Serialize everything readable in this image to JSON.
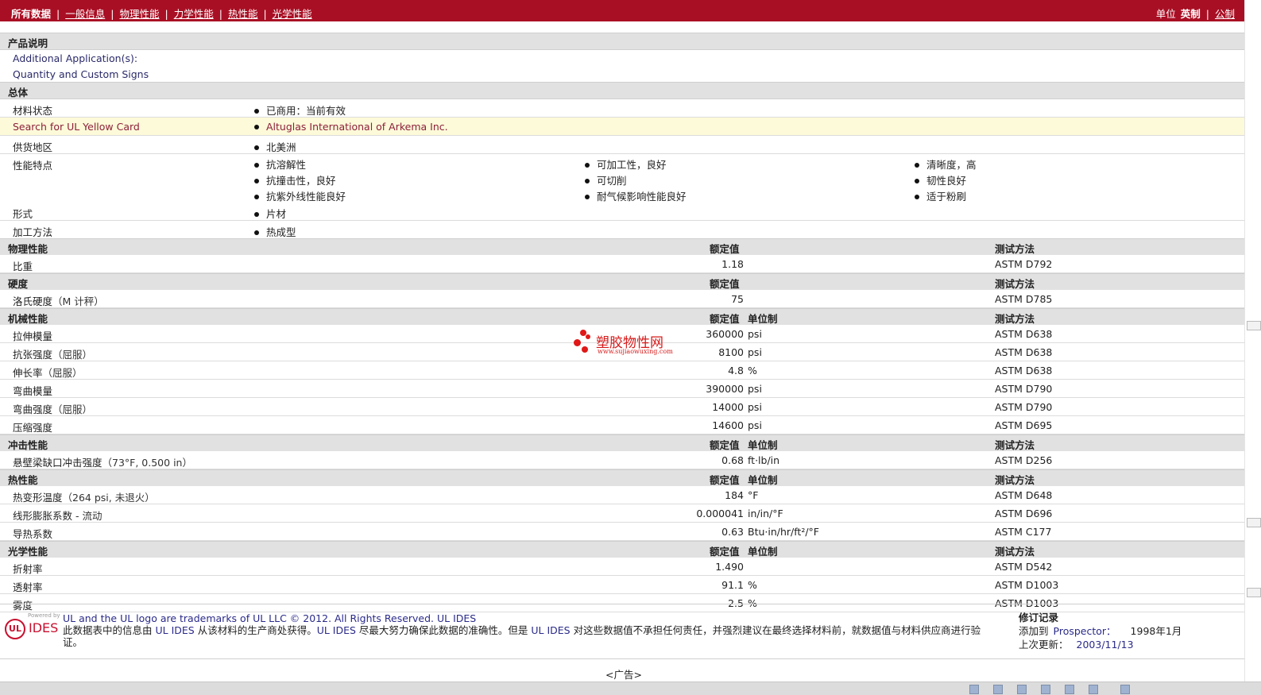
{
  "nav": {
    "tabs": [
      "所有数据",
      "一般信息",
      "物理性能",
      "力学性能",
      "热性能",
      "光学性能"
    ],
    "units_label": "单位",
    "units": [
      "英制",
      "公制"
    ]
  },
  "product_desc": {
    "heading": "产品说明",
    "line1": "Additional Application(s):",
    "line2": "Quantity and Custom Signs"
  },
  "general": {
    "heading": "总体",
    "rows": [
      {
        "label": "材料状态",
        "value": "已商用：当前有效"
      },
      {
        "label": "Search for UL Yellow Card",
        "value": "Altuglas International of Arkema Inc."
      },
      {
        "label": "供货地区",
        "value": "北美洲"
      }
    ],
    "features_label": "性能特点",
    "features": [
      [
        "抗溶解性",
        "抗撞击性，良好",
        "抗紫外线性能良好"
      ],
      [
        "可加工性，良好",
        "可切削",
        "耐气候影响性能良好"
      ],
      [
        "清晰度，高",
        "韧性良好",
        "适于粉刷"
      ]
    ],
    "form_label": "形式",
    "form": "片材",
    "process_label": "加工方法",
    "process": "热成型"
  },
  "headers": {
    "nominal": "额定值",
    "unit": "单位制",
    "test": "测试方法"
  },
  "sections": [
    {
      "title": "物理性能",
      "show_unit": false,
      "rows": [
        {
          "label": "比重",
          "note": "",
          "value": "1.18",
          "unit": "",
          "test": "ASTM D792"
        }
      ]
    },
    {
      "title": "硬度",
      "show_unit": false,
      "rows": [
        {
          "label": "洛氏硬度",
          "note": "（M 计秤）",
          "value": "75",
          "unit": "",
          "test": "ASTM D785"
        }
      ]
    },
    {
      "title": "机械性能",
      "show_unit": true,
      "rows": [
        {
          "label": "拉伸模量",
          "note": "",
          "value": "360000",
          "unit": "psi",
          "test": "ASTM D638"
        },
        {
          "label": "抗张强度",
          "note": "（屈服）",
          "value": "8100",
          "unit": "psi",
          "test": "ASTM D638"
        },
        {
          "label": "伸长率",
          "note": "（屈服）",
          "value": "4.8",
          "unit": "%",
          "test": "ASTM D638"
        },
        {
          "label": "弯曲模量",
          "note": "",
          "value": "390000",
          "unit": "psi",
          "test": "ASTM D790"
        },
        {
          "label": "弯曲强度",
          "note": "（屈服）",
          "value": "14000",
          "unit": "psi",
          "test": "ASTM D790"
        },
        {
          "label": "压缩强度",
          "note": "",
          "value": "14600",
          "unit": "psi",
          "test": "ASTM D695"
        }
      ]
    },
    {
      "title": "冲击性能",
      "show_unit": true,
      "rows": [
        {
          "label": "悬壁梁缺口冲击强度",
          "note": "（73°F, 0.500 in）",
          "value": "0.68",
          "unit": "ft·lb/in",
          "test": "ASTM D256"
        }
      ]
    },
    {
      "title": "热性能",
      "show_unit": true,
      "rows": [
        {
          "label": "热变形温度",
          "note": "（264 psi, 未退火）",
          "value": "184",
          "unit": "°F",
          "test": "ASTM D648"
        },
        {
          "label": "线形膨胀系数",
          "note": " - 流动",
          "value": "0.000041",
          "unit": "in/in/°F",
          "test": "ASTM D696"
        },
        {
          "label": "导热系数",
          "note": "",
          "value": "0.63",
          "unit": "Btu·in/hr/ft²/°F",
          "test": "ASTM C177"
        }
      ]
    },
    {
      "title": "光学性能",
      "show_unit": true,
      "rows": [
        {
          "label": "折射率",
          "note": "",
          "value": "1.490",
          "unit": "",
          "test": "ASTM D542"
        },
        {
          "label": "透射率",
          "note": "",
          "value": "91.1",
          "unit": "%",
          "test": "ASTM D1003"
        },
        {
          "label": "雾度",
          "note": "",
          "value": "2.5",
          "unit": "%",
          "test": "ASTM D1003"
        }
      ]
    }
  ],
  "watermark": {
    "cn": "塑胶物性网",
    "en": "www.sujiaowuxing.com"
  },
  "footer": {
    "logo_powered": "Powered by",
    "logo_ul": "UL",
    "logo_ides": "IDES",
    "trademark": "UL and the UL logo are trademarks of UL LLC © 2012. All Rights Reserved. UL IDES",
    "disclaimer_a": "此数据表中的信息由 ",
    "disclaimer_b": "UL IDES",
    "disclaimer_c": " 从该材料的生产商处获得。",
    "disclaimer_d": "UL IDES",
    "disclaimer_e": " 尽最大努力确保此数据的准确性。但是 ",
    "disclaimer_f": "UL IDES",
    "disclaimer_g": " 对这些数据值不承担任何责任，并强烈建议在最终选择材料前，就数据值与材料供应商进行验证。",
    "revision_title": "修订记录",
    "added_label": "添加到",
    "added_target": "Prospector：",
    "added_date": "1998年1月",
    "updated_label": "上次更新：",
    "updated_date": "2003/11/13"
  },
  "ad_label": "<广告>"
}
